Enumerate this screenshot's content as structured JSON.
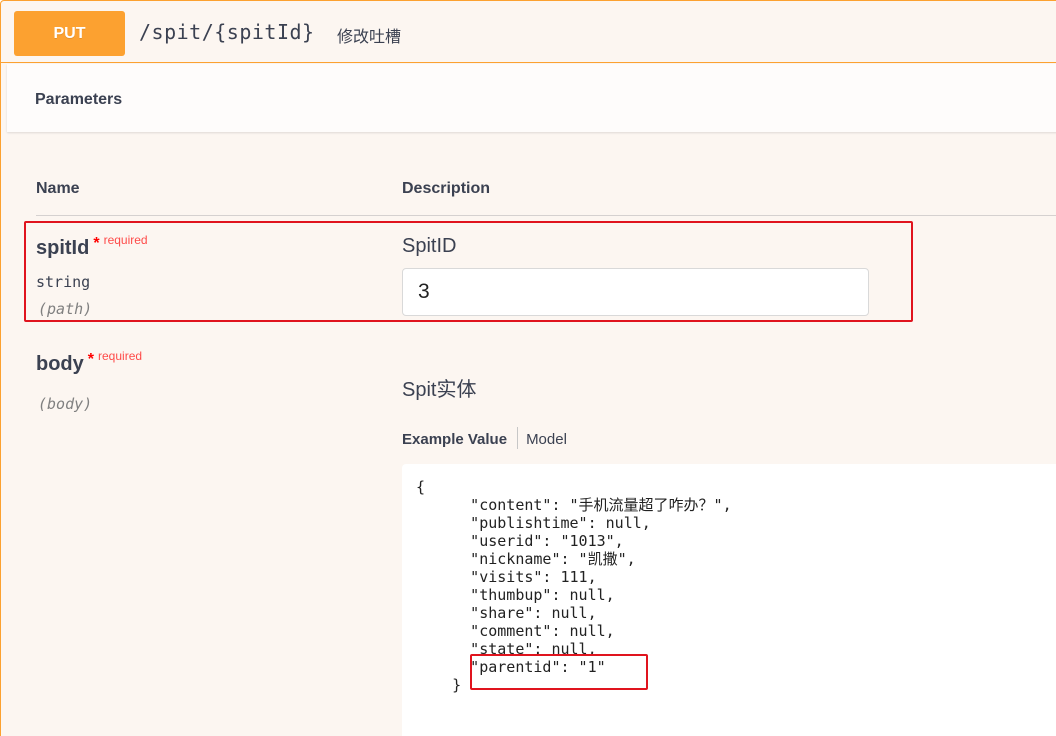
{
  "operation": {
    "method": "PUT",
    "path": "/spit/{spitId}",
    "summary": "修改吐槽"
  },
  "parameters_section": {
    "title": "Parameters",
    "col_name": "Name",
    "col_description": "Description"
  },
  "params": [
    {
      "name": "spitId",
      "star": "*",
      "required_label": "required",
      "type": "string",
      "in": "(path)",
      "description": "SpitID",
      "value": "3"
    },
    {
      "name": "body",
      "star": "*",
      "required_label": "required",
      "in": "(body)",
      "description": "Spit实体"
    }
  ],
  "body_tabs": {
    "example": "Example Value",
    "model": "Model"
  },
  "example_lines": [
    "{",
    "      \"content\": \"手机流量超了咋办？\",",
    "      \"publishtime\": null,",
    "      \"userid\": \"1013\",",
    "      \"nickname\": \"凯撒\",",
    "      \"visits\": 111,",
    "      \"thumbup\": null,",
    "      \"share\": null,",
    "      \"comment\": null,",
    "      \"state\": null,",
    "      \"parentid\": \"1\"",
    "    }"
  ],
  "colors": {
    "put_accent": "#fca130",
    "block_bg": "#fcf6f1",
    "highlight_red": "#e0141e"
  }
}
